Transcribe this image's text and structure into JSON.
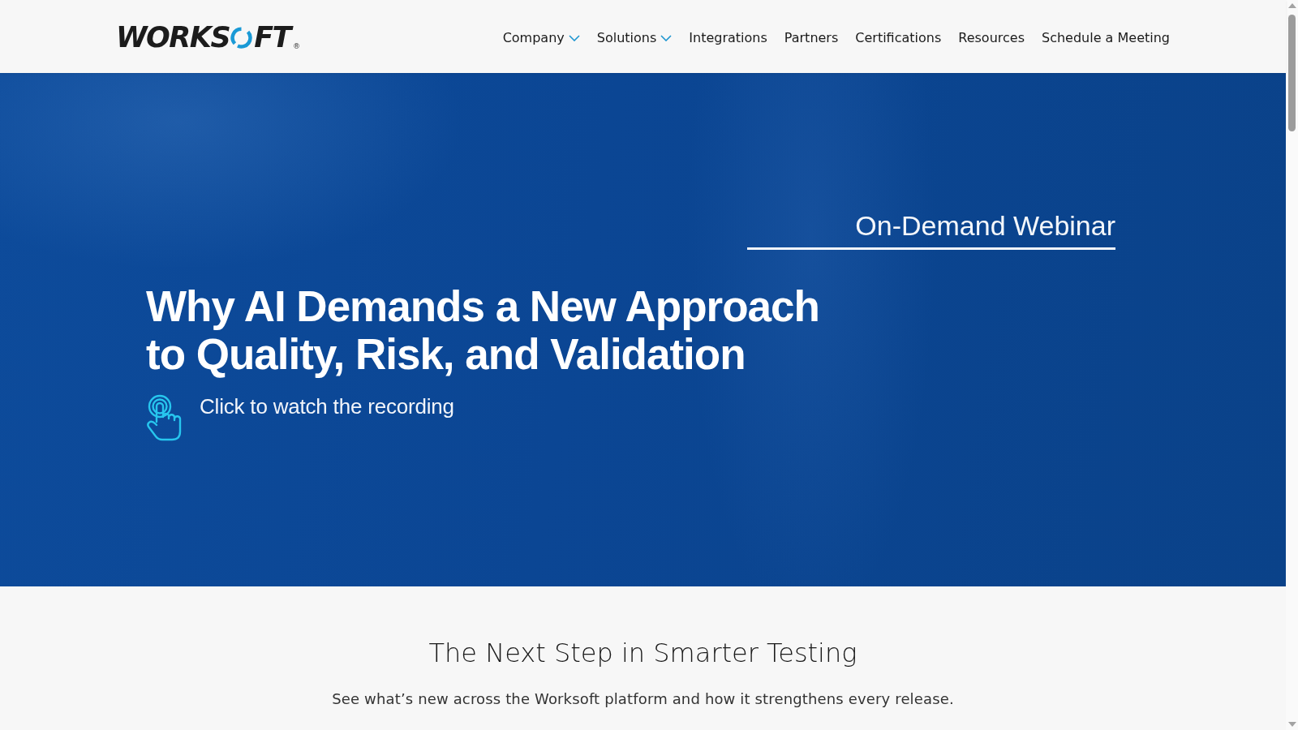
{
  "header": {
    "logo": {
      "left": "WORKS",
      "right": "FT",
      "registered": "®"
    },
    "nav": [
      {
        "label": "Company",
        "has_menu": true
      },
      {
        "label": "Solutions",
        "has_menu": true
      },
      {
        "label": "Integrations",
        "has_menu": false
      },
      {
        "label": "Partners",
        "has_menu": false
      },
      {
        "label": "Certifications",
        "has_menu": false
      },
      {
        "label": "Resources",
        "has_menu": false
      },
      {
        "label": "Schedule a Meeting",
        "has_menu": false
      }
    ]
  },
  "hero": {
    "eyebrow": "On-Demand Webinar",
    "title_lines": [
      "Why AI Demands a New Approach",
      "to Quality, Risk, and Validation"
    ],
    "cta": "Click to watch the recording"
  },
  "intro": {
    "heading": "The Next Step in Smarter Testing",
    "text": "See what’s new across the Worksoft platform and how it strengthens every release."
  }
}
